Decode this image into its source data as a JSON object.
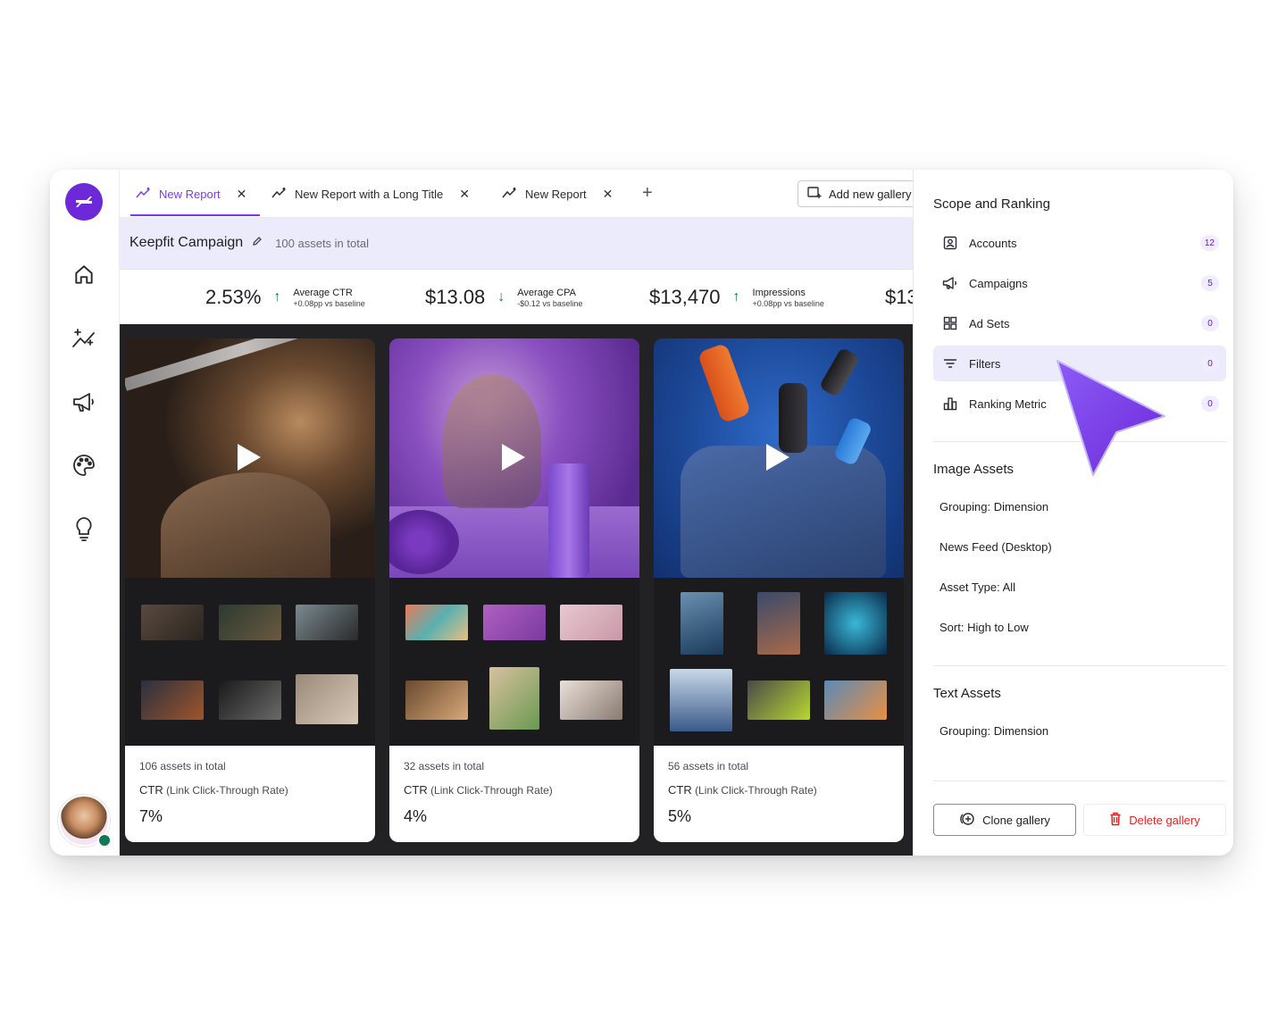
{
  "tabs": [
    {
      "label": "New Report",
      "active": true
    },
    {
      "label": "New Report with a Long Title",
      "active": false
    },
    {
      "label": "New Report",
      "active": false
    }
  ],
  "toolbar": {
    "add_tab": "+",
    "add_gallery": "Add new gallery"
  },
  "campaign": {
    "title": "Keepfit Campaign",
    "subtitle": "100 assets in total"
  },
  "metrics": [
    {
      "value": "2.53%",
      "label": "Average CTR",
      "delta": "+0.08pp vs baseline",
      "direction": "up"
    },
    {
      "value": "$13.08",
      "label": "Average CPA",
      "delta": "-$0.12 vs baseline",
      "direction": "down"
    },
    {
      "value": "$13,470",
      "label": "Impressions",
      "delta": "+0.08pp vs baseline",
      "direction": "up"
    },
    {
      "value": "$13",
      "label": "",
      "delta": "",
      "direction": ""
    }
  ],
  "cards": [
    {
      "count": "106 assets in total",
      "metric_abbr": "CTR",
      "metric_name": "(Link Click-Through Rate)",
      "value": "7%"
    },
    {
      "count": "32 assets in total",
      "metric_abbr": "CTR",
      "metric_name": "(Link Click-Through Rate)",
      "value": "4%"
    },
    {
      "count": "56 assets in total",
      "metric_abbr": "CTR",
      "metric_name": "(Link Click-Through Rate)",
      "value": "5%"
    }
  ],
  "panel": {
    "scope_title": "Scope and Ranking",
    "scope_items": [
      {
        "label": "Accounts",
        "count": "12",
        "icon": "account-icon"
      },
      {
        "label": "Campaigns",
        "count": "5",
        "icon": "megaphone-icon"
      },
      {
        "label": "Ad Sets",
        "count": "0",
        "icon": "grid-icon"
      },
      {
        "label": "Filters",
        "count": "0",
        "icon": "filter-icon",
        "active": true
      },
      {
        "label": "Ranking Metric",
        "count": "0",
        "icon": "bar-chart-icon"
      }
    ],
    "image_title": "Image Assets",
    "image_items": [
      "Grouping: Dimension",
      "News Feed (Desktop)",
      "Asset Type: All",
      "Sort: High to Low"
    ],
    "text_title": "Text Assets",
    "text_items": [
      "Grouping: Dimension"
    ],
    "clone_label": "Clone gallery",
    "delete_label": "Delete gallery"
  },
  "colors": {
    "accent": "#7c3aed",
    "brand": "#6d28d9",
    "positive": "#0f7a56",
    "danger": "#dc2626",
    "header_bg": "#ecebfb"
  }
}
